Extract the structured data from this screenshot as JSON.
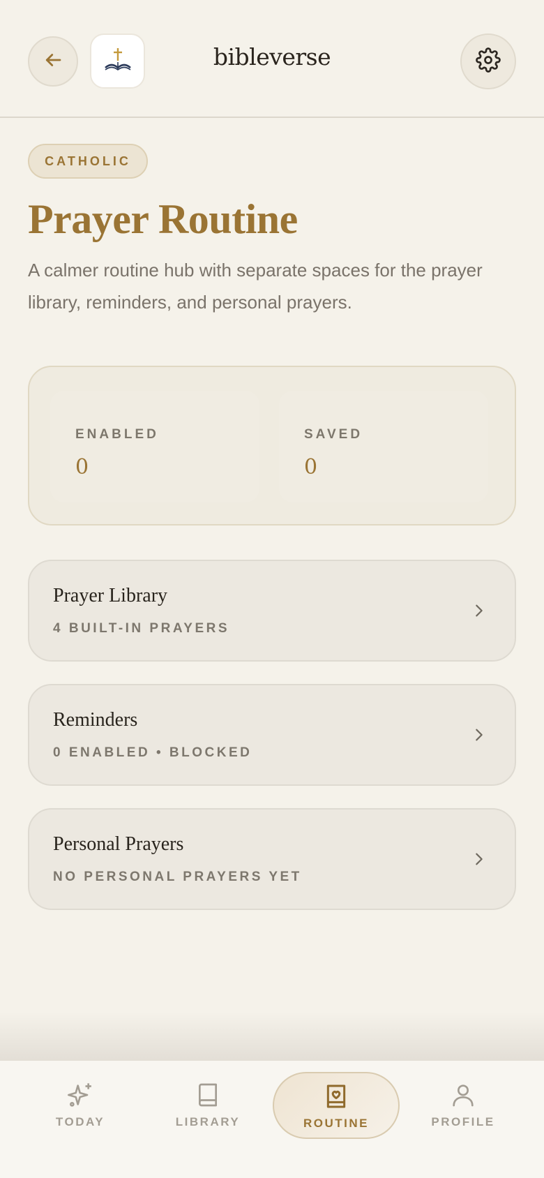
{
  "header": {
    "app_name": "bibleverse"
  },
  "badge": "CATHOLIC",
  "page": {
    "title": "Prayer Routine",
    "subtitle": "A calmer routine hub with separate spaces for the prayer library, reminders, and personal prayers."
  },
  "stats": [
    {
      "label": "ENABLED",
      "value": "0"
    },
    {
      "label": "SAVED",
      "value": "0"
    }
  ],
  "cards": [
    {
      "title": "Prayer Library",
      "subtitle": "4 BUILT-IN PRAYERS"
    },
    {
      "title": "Reminders",
      "subtitle": "0 ENABLED • BLOCKED"
    },
    {
      "title": "Personal Prayers",
      "subtitle": "NO PERSONAL PRAYERS YET"
    }
  ],
  "tabs": [
    {
      "label": "TODAY",
      "icon": "sparkle-icon"
    },
    {
      "label": "LIBRARY",
      "icon": "book-icon"
    },
    {
      "label": "ROUTINE",
      "icon": "prayer-book-heart-icon",
      "active": true
    },
    {
      "label": "PROFILE",
      "icon": "person-icon"
    }
  ],
  "colors": {
    "background": "#f5f2ea",
    "accent": "#9a7434",
    "muted_text": "#7d776c"
  }
}
